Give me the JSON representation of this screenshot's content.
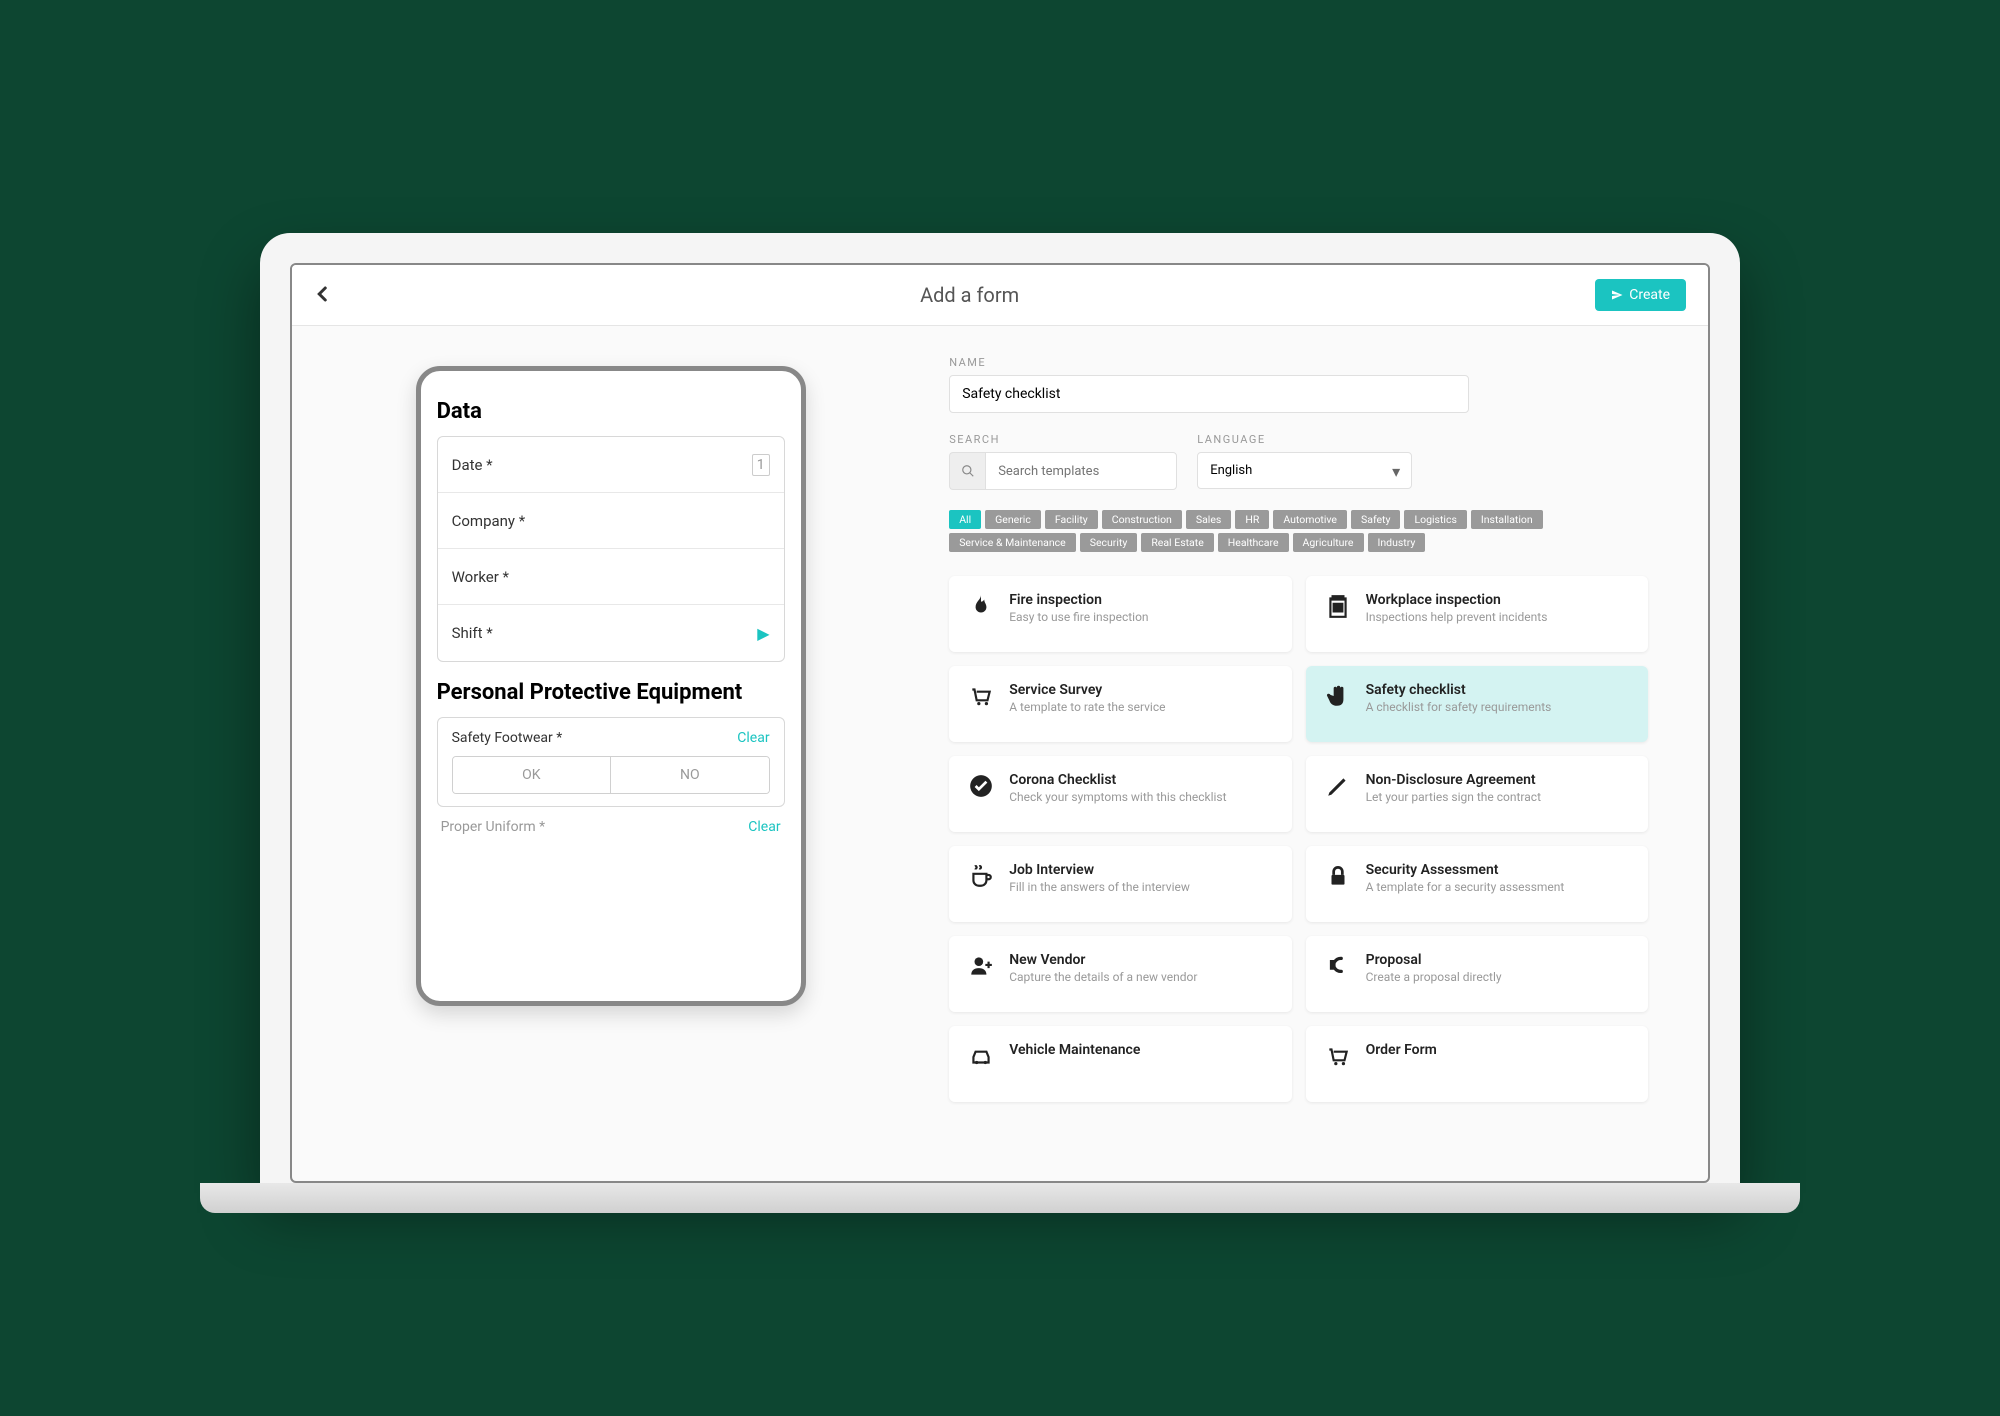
{
  "header": {
    "title": "Add a form",
    "create_label": "Create"
  },
  "preview": {
    "section1_title": "Data",
    "fields": [
      {
        "label": "Date *",
        "icon": "date"
      },
      {
        "label": "Company *"
      },
      {
        "label": "Worker *"
      },
      {
        "label": "Shift *",
        "icon": "play"
      }
    ],
    "section2_title": "Personal Protective Equipment",
    "ppe": [
      {
        "label": "Safety Footwear *",
        "clear": "Clear",
        "opt1": "OK",
        "opt2": "NO"
      },
      {
        "label": "Proper Uniform *",
        "clear": "Clear"
      }
    ]
  },
  "form": {
    "name_label": "NAME",
    "name_value": "Safety checklist",
    "search_label": "SEARCH",
    "search_placeholder": "Search templates",
    "language_label": "LANGUAGE",
    "language_value": "English"
  },
  "tags": [
    "All",
    "Generic",
    "Facility",
    "Construction",
    "Sales",
    "HR",
    "Automotive",
    "Safety",
    "Logistics",
    "Installation",
    "Service & Maintenance",
    "Security",
    "Real Estate",
    "Healthcare",
    "Agriculture",
    "Industry"
  ],
  "active_tag": "All",
  "templates": [
    {
      "icon": "fire",
      "title": "Fire inspection",
      "desc": "Easy to use fire inspection"
    },
    {
      "icon": "clipboard",
      "title": "Workplace inspection",
      "desc": "Inspections help prevent incidents"
    },
    {
      "icon": "cart",
      "title": "Service Survey",
      "desc": "A template to rate the service"
    },
    {
      "icon": "hand",
      "title": "Safety checklist",
      "desc": "A checklist for safety requirements",
      "selected": true
    },
    {
      "icon": "check",
      "title": "Corona Checklist",
      "desc": "Check your symptoms with this checklist"
    },
    {
      "icon": "pencil",
      "title": "Non-Disclosure Agreement",
      "desc": "Let your parties sign the contract"
    },
    {
      "icon": "coffee",
      "title": "Job Interview",
      "desc": "Fill in the answers of the interview"
    },
    {
      "icon": "lock",
      "title": "Security Assessment",
      "desc": "A template for a security assessment"
    },
    {
      "icon": "userplus",
      "title": "New Vendor",
      "desc": "Capture the details of a new vendor"
    },
    {
      "icon": "euro",
      "title": "Proposal",
      "desc": "Create a proposal directly"
    },
    {
      "icon": "car",
      "title": "Vehicle Maintenance",
      "desc": ""
    },
    {
      "icon": "cart2",
      "title": "Order Form",
      "desc": ""
    }
  ]
}
